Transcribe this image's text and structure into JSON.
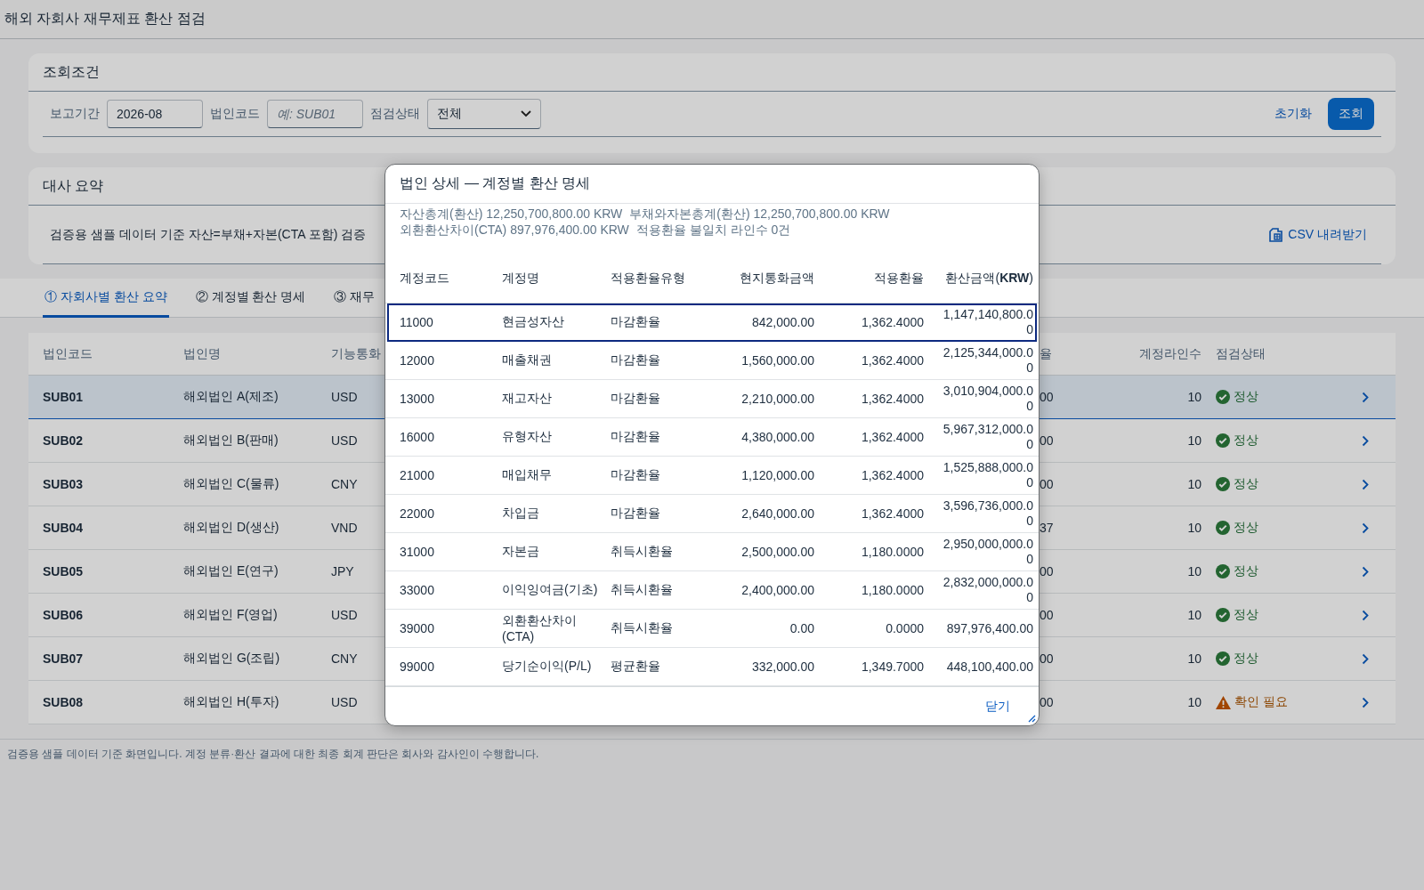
{
  "page_title": "해외 자회사 재무제표 환산 점검",
  "filters": {
    "title": "조회조건",
    "fields": [
      {
        "kind": "text",
        "label": "보고기간",
        "value": "2026-08"
      },
      {
        "kind": "text",
        "label": "법인코드",
        "placeholder": "예: SUB01"
      },
      {
        "kind": "select",
        "label": "점검상태",
        "value": "전체"
      }
    ],
    "reset": "초기화",
    "search": "조회"
  },
  "summary": {
    "title": "대사 요약",
    "text": "검증용 샘플 데이터 기준 자산=부채+자본(CTA 포함) 검증",
    "download": "CSV 내려받기"
  },
  "tabs": [
    {
      "label": "① 자회사별 환산 요약",
      "selected": true
    },
    {
      "label": "② 계정별 환산 명세",
      "selected": false
    },
    {
      "label": "③ 재무",
      "selected": false
    }
  ],
  "table": {
    "columns": [
      "법인코드",
      "법인명",
      "기능통화",
      "율",
      "계정라인수",
      "점검상태"
    ],
    "rows": [
      {
        "code": "SUB01",
        "name": "해외법인 A(제조)",
        "currency": "USD",
        "column_4": "00",
        "lines": "10",
        "status": {
          "kind": "ok",
          "label": "정상"
        },
        "selected": true
      },
      {
        "code": "SUB02",
        "name": "해외법인 B(판매)",
        "currency": "USD",
        "column_4": "00",
        "lines": "10",
        "status": {
          "kind": "ok",
          "label": "정상"
        },
        "selected": false
      },
      {
        "code": "SUB03",
        "name": "해외법인 C(물류)",
        "currency": "CNY",
        "column_4": "00",
        "lines": "10",
        "status": {
          "kind": "ok",
          "label": "정상"
        },
        "selected": false
      },
      {
        "code": "SUB04",
        "name": "해외법인 D(생산)",
        "currency": "VND",
        "column_4": "37",
        "lines": "10",
        "status": {
          "kind": "ok",
          "label": "정상"
        },
        "selected": false
      },
      {
        "code": "SUB05",
        "name": "해외법인 E(연구)",
        "currency": "JPY",
        "column_4": "00",
        "lines": "10",
        "status": {
          "kind": "ok",
          "label": "정상"
        },
        "selected": false
      },
      {
        "code": "SUB06",
        "name": "해외법인 F(영업)",
        "currency": "USD",
        "column_4": "00",
        "lines": "10",
        "status": {
          "kind": "ok",
          "label": "정상"
        },
        "selected": false
      },
      {
        "code": "SUB07",
        "name": "해외법인 G(조립)",
        "currency": "CNY",
        "column_4": "00",
        "lines": "10",
        "status": {
          "kind": "ok",
          "label": "정상"
        },
        "selected": false
      },
      {
        "code": "SUB08",
        "name": "해외법인 H(투자)",
        "currency": "USD",
        "column_4": "00",
        "lines": "10",
        "status": {
          "kind": "warning",
          "label": "확인 필요"
        },
        "selected": false
      }
    ]
  },
  "footer": "검증용 샘플 데이터 기준 화면입니다. 계정 분류·환산 결과에 대한 최종 회계 판단은 회사와 감사인이 수행합니다.",
  "dialog": {
    "title": "법인 상세 — 계정별 환산 명세",
    "summary_lines": [
      [
        "자산총계(환산) 12,250,700,800.00 KRW",
        "부채와자본총계(환산) 12,250,700,800.00 KRW"
      ],
      [
        "외환환산차이(CTA) 897,976,400.00 KRW",
        "적용환율 불일치 라인수 0건"
      ]
    ],
    "columns": [
      "계정코드",
      "계정명",
      "적용환율유형",
      "현지통화금액",
      "적용환율",
      "환산금액(**KRW**)"
    ],
    "rows": [
      {
        "code": "11000",
        "name": "현금성자산",
        "rate_type": "마감환율",
        "local": "842,000.00",
        "rate": "1,362.4000",
        "krw": "1,147,140,800.00",
        "selected": true
      },
      {
        "code": "12000",
        "name": "매출채권",
        "rate_type": "마감환율",
        "local": "1,560,000.00",
        "rate": "1,362.4000",
        "krw": "2,125,344,000.00",
        "selected": false
      },
      {
        "code": "13000",
        "name": "재고자산",
        "rate_type": "마감환율",
        "local": "2,210,000.00",
        "rate": "1,362.4000",
        "krw": "3,010,904,000.00",
        "selected": false
      },
      {
        "code": "16000",
        "name": "유형자산",
        "rate_type": "마감환율",
        "local": "4,380,000.00",
        "rate": "1,362.4000",
        "krw": "5,967,312,000.00",
        "selected": false
      },
      {
        "code": "21000",
        "name": "매입채무",
        "rate_type": "마감환율",
        "local": "1,120,000.00",
        "rate": "1,362.4000",
        "krw": "1,525,888,000.00",
        "selected": false
      },
      {
        "code": "22000",
        "name": "차입금",
        "rate_type": "마감환율",
        "local": "2,640,000.00",
        "rate": "1,362.4000",
        "krw": "3,596,736,000.00",
        "selected": false
      },
      {
        "code": "31000",
        "name": "자본금",
        "rate_type": "취득시환율",
        "local": "2,500,000.00",
        "rate": "1,180.0000",
        "krw": "2,950,000,000.00",
        "selected": false
      },
      {
        "code": "33000",
        "name": "이익잉여금(기초)",
        "rate_type": "취득시환율",
        "local": "2,400,000.00",
        "rate": "1,180.0000",
        "krw": "2,832,000,000.00",
        "selected": false
      },
      {
        "code": "39000",
        "name": "외환환산차이(CTA)",
        "rate_type": "취득시환율",
        "local": "0.00",
        "rate": "0.0000",
        "krw": "897,976,400.00",
        "selected": false
      },
      {
        "code": "99000",
        "name": "당기순이익(P/L)",
        "rate_type": "평균환율",
        "local": "332,000.00",
        "rate": "1,349.7000",
        "krw": "448,100,400.00",
        "selected": false
      }
    ],
    "close": "닫기"
  }
}
